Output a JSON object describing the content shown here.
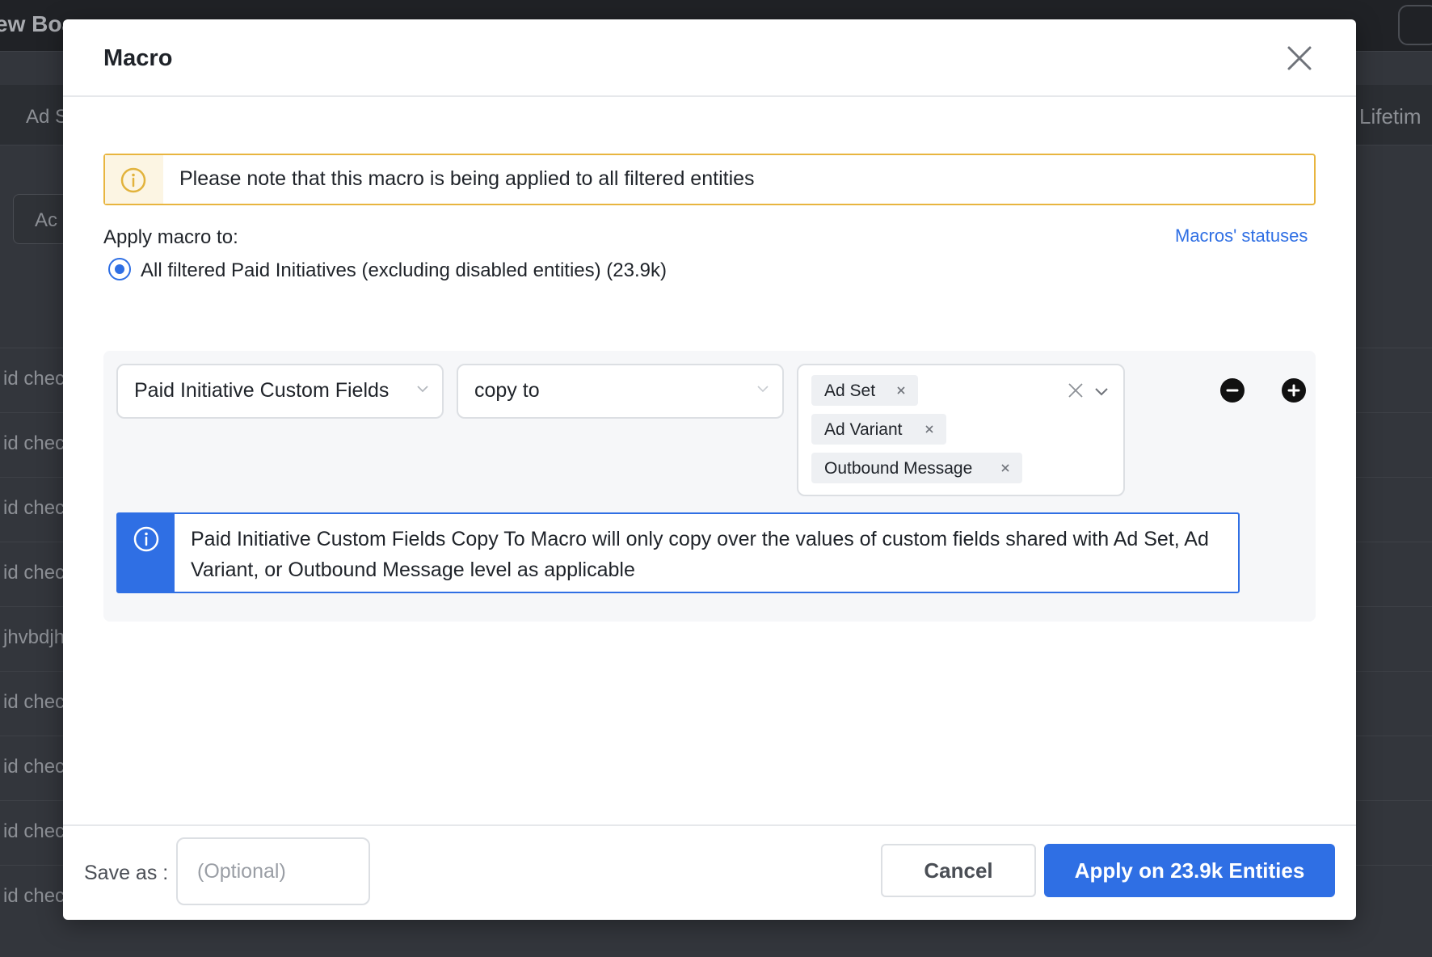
{
  "background": {
    "board_title": "ew Boa",
    "subbar_left": "Ad S",
    "subbar_right": "Lifetim",
    "button_text": "Ac",
    "rows": [
      "id chec",
      "id chec",
      "id chec",
      "id chec",
      "jhvbdjh",
      "id chec",
      "id chec",
      "id chec",
      "id chec"
    ]
  },
  "modal": {
    "title": "Macro",
    "warning": "Please note that this macro is being applied to all filtered entities",
    "apply_label": "Apply macro to:",
    "statuses_link": "Macros' statuses",
    "radio_option": "All filtered Paid Initiatives (excluding disabled entities) (23.9k)",
    "rule": {
      "field": "Paid Initiative Custom Fields",
      "operator": "copy to",
      "targets": [
        "Ad Set",
        "Ad Variant",
        "Outbound Message"
      ]
    },
    "info": "Paid Initiative Custom Fields Copy To Macro will only copy over the values of custom fields shared with Ad Set, Ad Variant, or Outbound Message level as applicable",
    "footer": {
      "save_label": "Save as :",
      "save_placeholder": "(Optional)",
      "cancel": "Cancel",
      "apply": "Apply on 23.9k Entities"
    }
  },
  "colors": {
    "primary": "#2f6fe4",
    "warning_border": "#e8b53f",
    "warning_icon": "#e2b33c"
  },
  "icons": {
    "close": "close-icon",
    "warning": "warning-info-icon",
    "chevron": "chevron-down-icon",
    "tag_remove": "close-small-icon",
    "clear": "clear-icon",
    "minus": "minus-circle-icon",
    "plus": "plus-circle-icon",
    "info": "info-icon"
  }
}
